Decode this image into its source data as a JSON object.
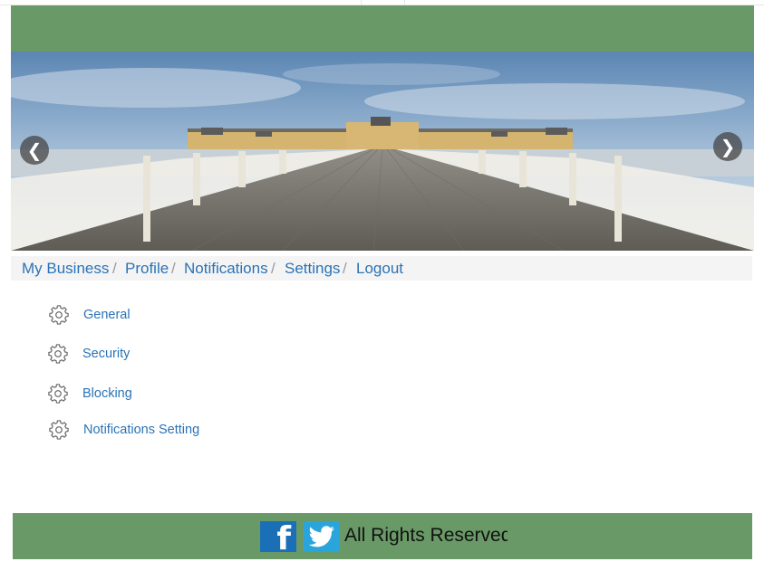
{
  "header": {
    "background": "#699966"
  },
  "carousel": {
    "prev_icon": "chevron-left-icon",
    "next_icon": "chevron-right-icon",
    "prev_glyph": "❮",
    "next_glyph": "❯"
  },
  "breadcrumb": {
    "items": [
      "My Business",
      "Profile",
      "Notifications",
      "Settings",
      "Logout"
    ],
    "separator": "/"
  },
  "settings": {
    "icon": "gear-icon",
    "items": [
      "General",
      "Security",
      "Blocking",
      "Notifications Setting"
    ]
  },
  "footer": {
    "background": "#699966",
    "facebook_icon": "facebook-icon",
    "facebook_glyph": "f",
    "twitter_icon": "twitter-icon",
    "text": "All Rights Reserved"
  },
  "colors": {
    "link": "#2a73b6",
    "bar": "#699966"
  }
}
